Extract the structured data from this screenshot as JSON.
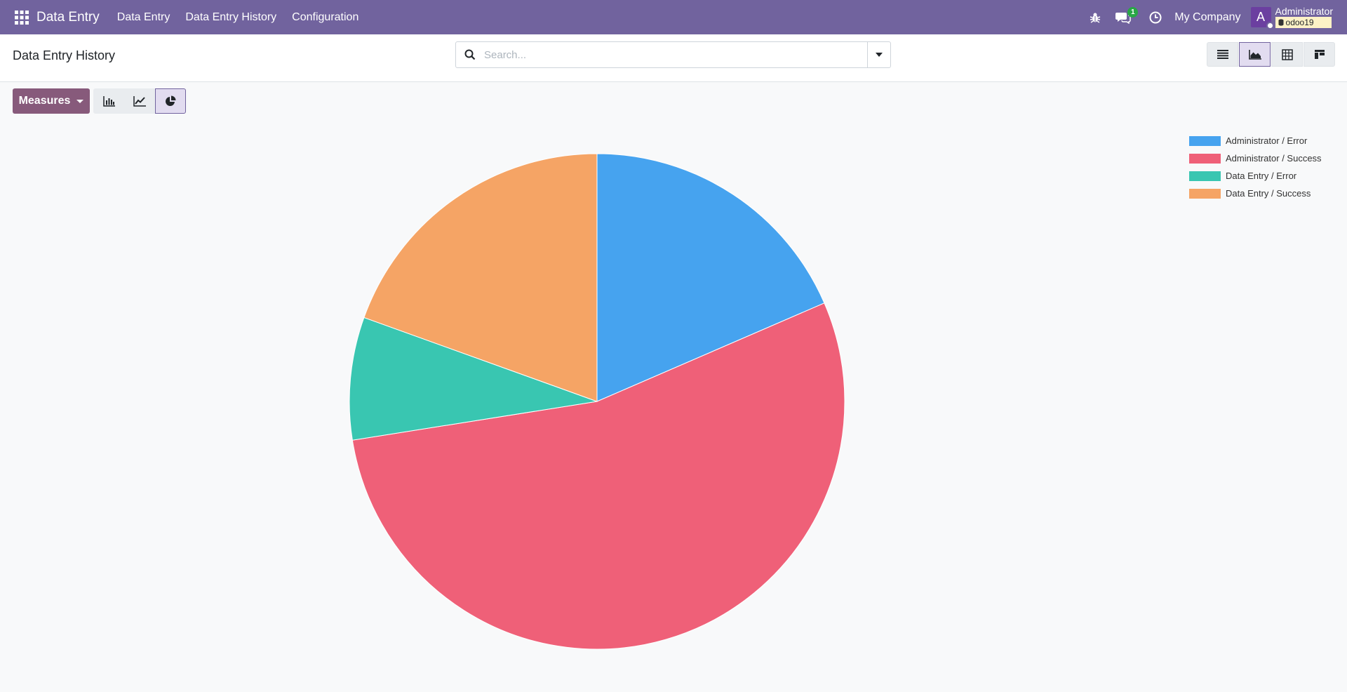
{
  "navbar": {
    "brand": "Data Entry",
    "menu": [
      "Data Entry",
      "Data Entry History",
      "Configuration"
    ],
    "message_count": "1",
    "company": "My Company",
    "avatar_initial": "A",
    "user": "Administrator",
    "database": "odoo19",
    "icons": [
      "apps-grid-icon",
      "bug-icon",
      "chat-icon",
      "clock-icon"
    ]
  },
  "control_panel": {
    "breadcrumb": "Data Entry History",
    "search": {
      "placeholder": "Search...",
      "value": ""
    },
    "views": [
      {
        "name": "list",
        "icon": "list-icon",
        "active": false
      },
      {
        "name": "graph",
        "icon": "area-chart-icon",
        "active": true
      },
      {
        "name": "pivot",
        "icon": "pivot-table-icon",
        "active": false
      },
      {
        "name": "kanban",
        "icon": "kanban-icon",
        "active": false
      }
    ]
  },
  "toolbar": {
    "measures_label": "Measures",
    "modes": [
      {
        "name": "bar",
        "icon": "bar-chart-icon",
        "active": false
      },
      {
        "name": "line",
        "icon": "line-chart-icon",
        "active": false
      },
      {
        "name": "pie",
        "icon": "pie-chart-icon",
        "active": true
      }
    ]
  },
  "chart_data": {
    "type": "pie",
    "categories": [
      "Administrator / Error",
      "Administrator / Success",
      "Data Entry / Error",
      "Data Entry / Success"
    ],
    "values": [
      18.5,
      54,
      8,
      19.5
    ],
    "colors": [
      "#46a3ef",
      "#ef6078",
      "#39c6b1",
      "#f5a465"
    ],
    "legend_position": "top-right",
    "title": ""
  }
}
